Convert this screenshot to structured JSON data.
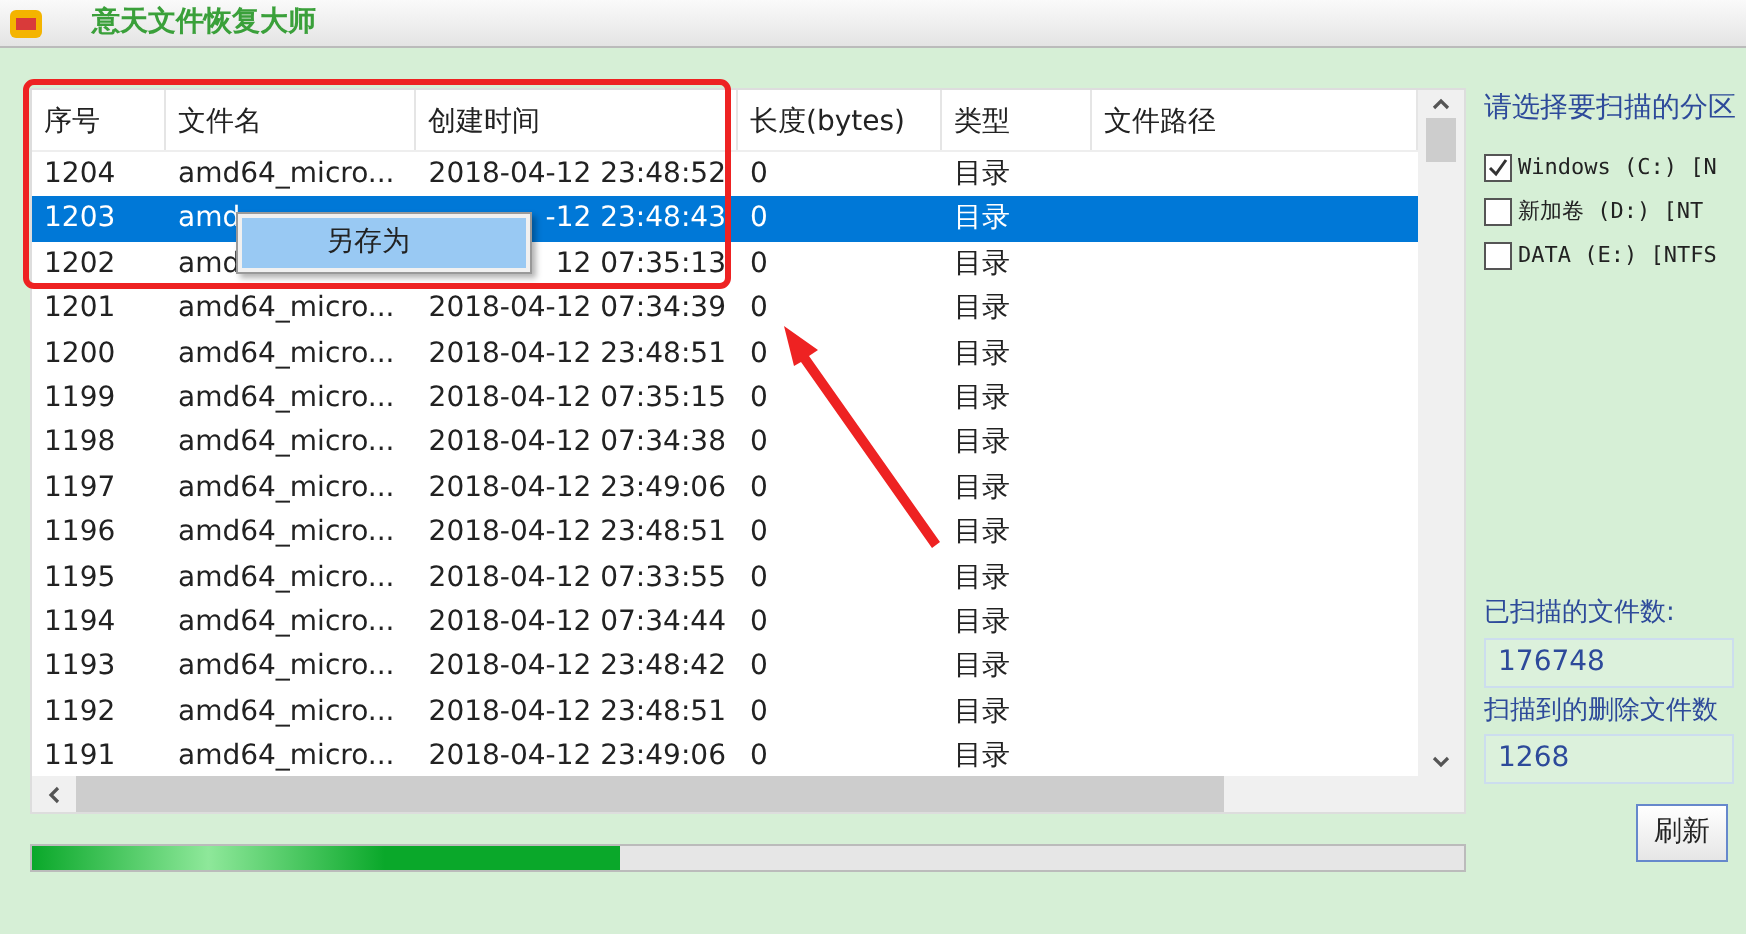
{
  "window": {
    "title": "意天文件恢复大师"
  },
  "file_table": {
    "columns": [
      "序号",
      "文件名",
      "创建时间",
      "长度(bytes)",
      "类型",
      "文件路径"
    ],
    "rows": [
      {
        "cells": [
          "1204",
          "amd64_micro...",
          "2018-04-12 23:48:52",
          "0",
          "目录",
          ""
        ],
        "selected": false
      },
      {
        "cells": [
          "1203",
          "amd",
          "-12 23:48:43",
          "0",
          "目录",
          ""
        ],
        "selected": true
      },
      {
        "cells": [
          "1202",
          "amd",
          "12 07:35:13",
          "0",
          "目录",
          ""
        ],
        "selected": false
      },
      {
        "cells": [
          "1201",
          "amd64_micro...",
          "2018-04-12 07:34:39",
          "0",
          "目录",
          ""
        ],
        "selected": false
      },
      {
        "cells": [
          "1200",
          "amd64_micro...",
          "2018-04-12 23:48:51",
          "0",
          "目录",
          ""
        ],
        "selected": false
      },
      {
        "cells": [
          "1199",
          "amd64_micro...",
          "2018-04-12 07:35:15",
          "0",
          "目录",
          ""
        ],
        "selected": false
      },
      {
        "cells": [
          "1198",
          "amd64_micro...",
          "2018-04-12 07:34:38",
          "0",
          "目录",
          ""
        ],
        "selected": false
      },
      {
        "cells": [
          "1197",
          "amd64_micro...",
          "2018-04-12 23:49:06",
          "0",
          "目录",
          ""
        ],
        "selected": false
      },
      {
        "cells": [
          "1196",
          "amd64_micro...",
          "2018-04-12 23:48:51",
          "0",
          "目录",
          ""
        ],
        "selected": false
      },
      {
        "cells": [
          "1195",
          "amd64_micro...",
          "2018-04-12 07:33:55",
          "0",
          "目录",
          ""
        ],
        "selected": false
      },
      {
        "cells": [
          "1194",
          "amd64_micro...",
          "2018-04-12 07:34:44",
          "0",
          "目录",
          ""
        ],
        "selected": false
      },
      {
        "cells": [
          "1193",
          "amd64_micro...",
          "2018-04-12 23:48:42",
          "0",
          "目录",
          ""
        ],
        "selected": false
      },
      {
        "cells": [
          "1192",
          "amd64_micro...",
          "2018-04-12 23:48:51",
          "0",
          "目录",
          ""
        ],
        "selected": false
      },
      {
        "cells": [
          "1191",
          "amd64_micro...",
          "2018-04-12 23:49:06",
          "0",
          "目录",
          ""
        ],
        "selected": false
      }
    ]
  },
  "context_menu": {
    "items": [
      {
        "label": "另存为",
        "selected": true
      }
    ]
  },
  "partitions": {
    "prompt": "请选择要扫描的分区",
    "items": [
      {
        "label": "Windows (C:) [N",
        "checked": true
      },
      {
        "label": "新加卷 (D:) [NT",
        "checked": false
      },
      {
        "label": "DATA (E:) [NTFS",
        "checked": false
      }
    ]
  },
  "scanned_count": {
    "label": "已扫描的文件数:",
    "value": "176748"
  },
  "deleted_count": {
    "label": "扫描到的删除文件数",
    "value": "1268"
  },
  "refresh_button": {
    "label": "刷新"
  },
  "progress": {
    "level": 0.41
  }
}
